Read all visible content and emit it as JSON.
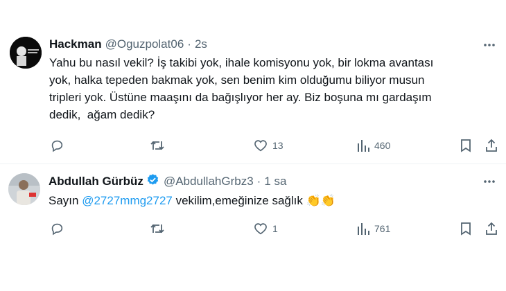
{
  "tweets": [
    {
      "name": "Hackman",
      "handle": "@Oguzpolat06",
      "dot": "·",
      "time": "2s",
      "body_lines": [
        "Yahu bu nasıl vekil? İş takibi yok, ihale komisyonu yok, bir lokma avantası",
        "yok, halka tepeden bakmak yok, sen benim kim olduğumu biliyor musun",
        "tripleri yok. Üstüne maaşını da bağışlıyor her ay. Biz boşuna mı gardaşım",
        "dedik,  ağam dedik?"
      ],
      "reply_count": "",
      "retweet_count": "",
      "like_count": "13",
      "view_count": "460"
    },
    {
      "name": "Abdullah Gürbüz",
      "handle": "@AbdullahGrbz3",
      "dot": "·",
      "time": "1 sa",
      "body_prefix": "Sayın ",
      "mention": "@2727mmg2727",
      "body_suffix": " vekilim,emeğinize sağlık ",
      "emoji": "👏👏",
      "reply_count": "",
      "retweet_count": "",
      "like_count": "1",
      "view_count": "761"
    }
  ],
  "colors": {
    "text": "#0f1419",
    "muted": "#536471",
    "link": "#1d9bf0",
    "verified": "#1d9bf0"
  },
  "icons": [
    "reply-icon",
    "retweet-icon",
    "like-icon",
    "views-icon",
    "bookmark-icon",
    "share-icon",
    "more-icon",
    "verified-badge-icon"
  ]
}
